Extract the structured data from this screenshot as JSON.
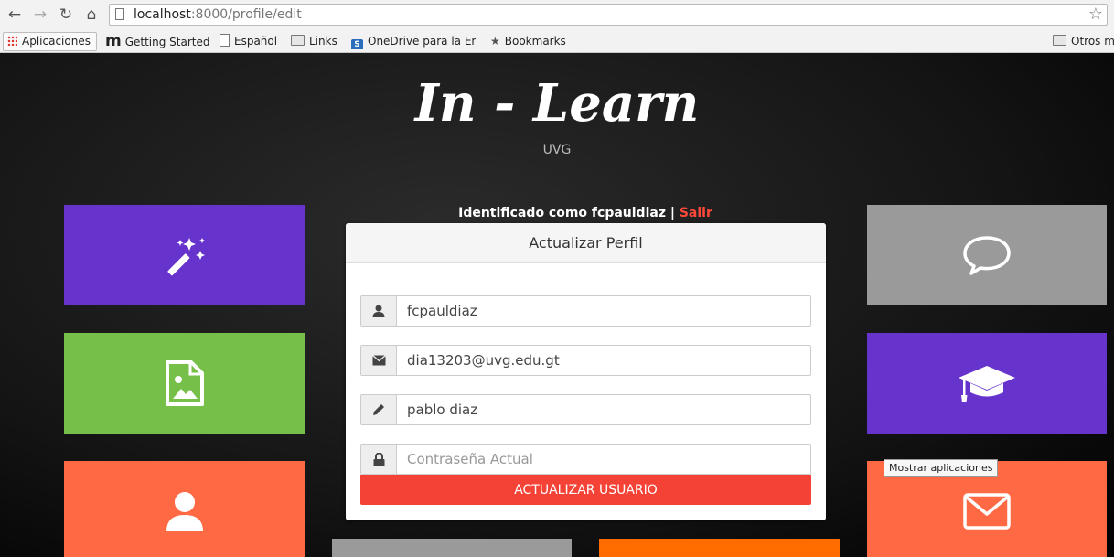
{
  "browser": {
    "url_host": "localhost",
    "url_path": ":8000/profile/edit",
    "bookmarks": [
      {
        "label": "Aplicaciones",
        "icon": "apps-icon"
      },
      {
        "label": "Getting Started",
        "icon": "m-logo-icon"
      },
      {
        "label": "Español",
        "icon": "page-icon"
      },
      {
        "label": "Links",
        "icon": "folder-icon"
      },
      {
        "label": "OneDrive para la Em",
        "icon": "sharepoint-icon"
      },
      {
        "label": "Bookmarks",
        "icon": "star-icon"
      },
      {
        "label": "Otros ma",
        "icon": "folder-icon"
      }
    ]
  },
  "header": {
    "title": "In - Learn",
    "subtitle": "UVG"
  },
  "identity": {
    "prefix": "Identificado como fcpauldiaz",
    "separator": " | ",
    "logout": "Salir"
  },
  "form": {
    "title": "Actualizar Perfil",
    "username_value": "fcpauldiaz",
    "email_value": "dia13203@uvg.edu.gt",
    "name_value": "pablo diaz",
    "password_placeholder": "Contraseña Actual",
    "submit_label": "ACTUALIZAR USUARIO"
  },
  "tooltip": "Mostrar aplicaciones",
  "colors": {
    "purple": "#6633cc",
    "green": "#76c04a",
    "orange_red": "#ff6a45",
    "gray": "#9a9a9a",
    "orange": "#ff6d00",
    "button_red": "#f44336"
  },
  "tiles": [
    {
      "name": "magic-wand-icon",
      "color": "purple"
    },
    {
      "name": "image-file-icon",
      "color": "green"
    },
    {
      "name": "user-icon",
      "color": "orange_red"
    },
    {
      "name": "chat-bubble-icon",
      "color": "gray"
    },
    {
      "name": "graduation-cap-icon",
      "color": "purple"
    },
    {
      "name": "envelope-icon",
      "color": "orange_red"
    }
  ]
}
